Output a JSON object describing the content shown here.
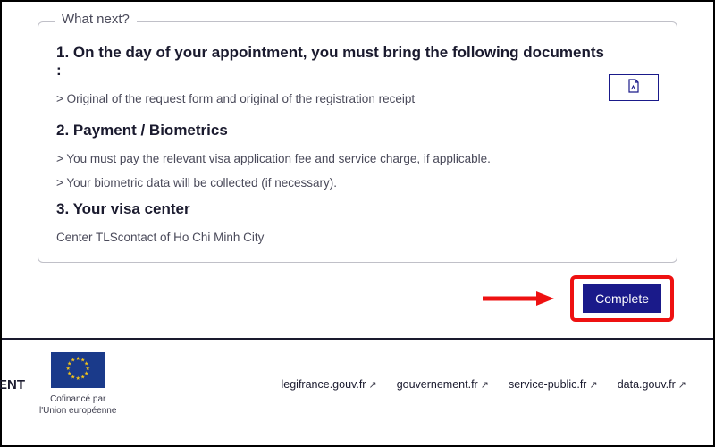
{
  "panel": {
    "legend": "What next?",
    "section1": {
      "heading": "1. On the day of your appointment, you must bring the following documents :",
      "line1": "> Original of the request form and original of the registration receipt"
    },
    "section2": {
      "heading": "2. Payment / Biometrics",
      "line1": "> You must pay the relevant visa application fee and service charge, if applicable.",
      "line2": "> Your biometric data will be collected (if necessary)."
    },
    "section3": {
      "heading": "3. Your visa center",
      "line1": "Center TLScontact of Ho Chi Minh City"
    }
  },
  "actions": {
    "complete_label": "Complete"
  },
  "footer": {
    "ent": "ENT",
    "eu_line1": "Cofinancé par",
    "eu_line2": "l'Union européenne",
    "links": [
      "legifrance.gouv.fr",
      "gouvernement.fr",
      "service-public.fr",
      "data.gouv.fr"
    ]
  }
}
